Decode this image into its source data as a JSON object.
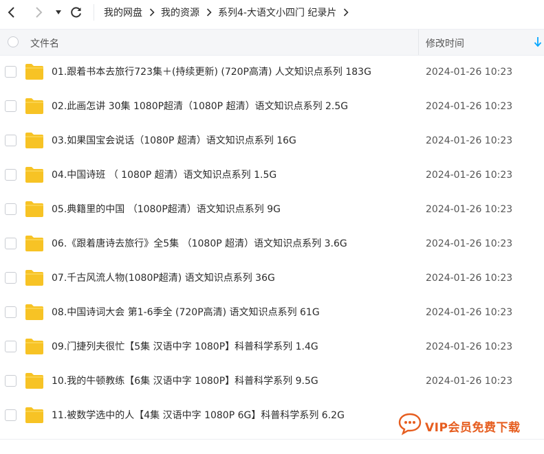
{
  "breadcrumb": [
    "我的网盘",
    "我的资源",
    "系列4-大语文小四门 纪录片"
  ],
  "header": {
    "name_label": "文件名",
    "time_label": "修改时间"
  },
  "files": [
    {
      "name": "01.跟着书本去旅行723集＋(持续更新) (720P高清) 人文知识点系列 183G",
      "modified": "2024-01-26 10:23",
      "icon": "folder-icon"
    },
    {
      "name": "02.此画怎讲 30集 1080P超清（1080P 超清）语文知识点系列 2.5G",
      "modified": "2024-01-26 10:23",
      "icon": "folder-icon"
    },
    {
      "name": "03.如果国宝会说话（1080P 超清）语文知识点系列 16G",
      "modified": "2024-01-26 10:23",
      "icon": "folder-icon"
    },
    {
      "name": "04.中国诗班 （ 1080P 超清）语文知识点系列 1.5G",
      "modified": "2024-01-26 10:23",
      "icon": "folder-icon"
    },
    {
      "name": "05.典籍里的中国 （1080P超清）语文知识点系列 9G",
      "modified": "2024-01-26 10:23",
      "icon": "folder-icon"
    },
    {
      "name": "06.《跟着唐诗去旅行》全5集 （1080P 超清）语文知识点系列 3.6G",
      "modified": "2024-01-26 10:23",
      "icon": "folder-icon"
    },
    {
      "name": "07.千古风流人物(1080P超清) 语文知识点系列 36G",
      "modified": "2024-01-26 10:23",
      "icon": "folder-icon"
    },
    {
      "name": "08.中国诗词大会 第1-6季全 (720P高清) 语文知识点系列 61G",
      "modified": "2024-01-26 10:23",
      "icon": "folder-icon"
    },
    {
      "name": "09.门捷列夫很忙【5集 汉语中字 1080P】科普科学系列 1.4G",
      "modified": "2024-01-26 10:23",
      "icon": "folder-icon"
    },
    {
      "name": "10.我的牛顿教练【6集 汉语中字 1080P】科普科学系列 9.5G",
      "modified": "2024-01-26 10:23",
      "icon": "folder-icon"
    },
    {
      "name": "11.被数学选中的人【4集 汉语中字 1080P 6G】科普科学系列 6.2G",
      "modified": "",
      "icon": "folder-icon"
    }
  ],
  "watermark": {
    "text": "VIP会员免费下载",
    "icon": "chat-bubble-icon",
    "color": "#e65d1f"
  },
  "colors": {
    "folder": "#f7c325",
    "accent": "#06a7ff",
    "header_bg": "#f5f6f8"
  }
}
